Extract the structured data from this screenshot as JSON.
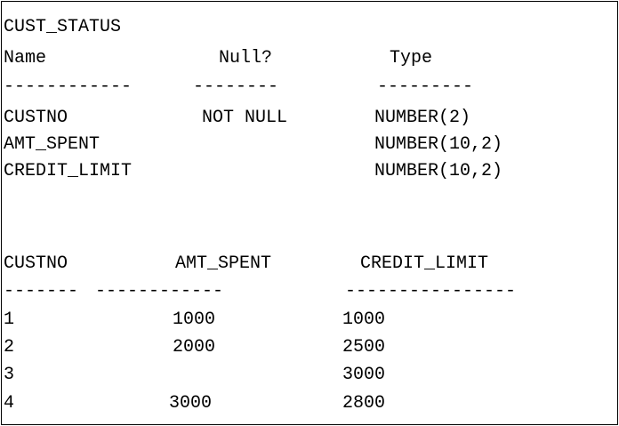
{
  "describe": {
    "table_name": "CUST_STATUS",
    "headers": {
      "name": "Name",
      "null": "Null?",
      "type": "Type"
    },
    "separators": {
      "name": "------------",
      "null": "--------",
      "type": "---------"
    },
    "columns": [
      {
        "name": "CUSTNO",
        "null": "NOT NULL",
        "type": "NUMBER(2)"
      },
      {
        "name": "AMT_SPENT",
        "null": "",
        "type": "NUMBER(10,2)"
      },
      {
        "name": "CREDIT_LIMIT",
        "null": "",
        "type": "NUMBER(10,2)"
      }
    ]
  },
  "query_result": {
    "headers": {
      "custno": "CUSTNO",
      "amt_spent": "AMT_SPENT",
      "credit_limit": "CREDIT_LIMIT"
    },
    "separators": {
      "custno": "-------",
      "amt_spent": "------------",
      "credit_limit": "----------------"
    },
    "rows": [
      {
        "custno": "1",
        "amt_spent": "1000",
        "credit_limit": "1000"
      },
      {
        "custno": "2",
        "amt_spent": "2000",
        "credit_limit": "2500"
      },
      {
        "custno": "3",
        "amt_spent": "",
        "credit_limit": "3000"
      },
      {
        "custno": "4",
        "amt_spent": "3000",
        "credit_limit": "2800"
      }
    ]
  }
}
